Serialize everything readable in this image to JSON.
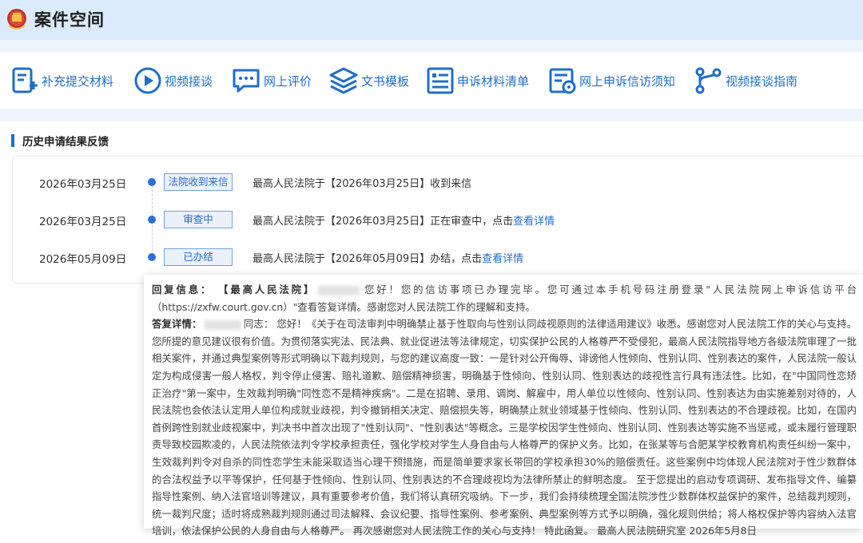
{
  "app": {
    "title": "案件空间"
  },
  "toolbar": {
    "items": [
      {
        "label": "补充提交材料",
        "icon": "document-add-icon"
      },
      {
        "label": "视频接谈",
        "icon": "play-circle-icon"
      },
      {
        "label": "网上评价",
        "icon": "chat-bubble-icon"
      },
      {
        "label": "文书模板",
        "icon": "layers-icon"
      },
      {
        "label": "申诉材料清单",
        "icon": "list-icon"
      },
      {
        "label": "网上申诉信访须知",
        "icon": "notice-icon"
      },
      {
        "label": "视频接谈指南",
        "icon": "flow-icon"
      }
    ]
  },
  "history": {
    "title": "历史申请结果反馈",
    "rows": [
      {
        "date": "2026年03月25日",
        "status": "法院收到来信",
        "text": "最高人民法院于【2026年03月25日】收到来信",
        "link": ""
      },
      {
        "date": "2026年03月25日",
        "status": "审查中",
        "text": "最高人民法院于【2026年03月25日】正在审查中，点击",
        "link": "查看详情"
      },
      {
        "date": "2026年05月09日",
        "status": "已办结",
        "text": "最高人民法院于【2026年05月09日】办结，点击",
        "link": "查看详情"
      }
    ]
  },
  "reply": {
    "info_label": "回复信息：",
    "info_org": "【最高人民法院】",
    "info_text": "您好！您的信访事项已办理完毕。您可通过本手机号码注册登录\"人民法院网上申诉信访平台（https://zxfw.court.gov.cn）\"查看答复详情。感谢您对人民法院工作的理解和支持。",
    "detail_label": "答复详情：",
    "detail_salutation": "同志：",
    "detail_text": "您好！《关于在司法审判中明确禁止基于性取向与性别认同歧视原则的法律适用建议》收悉。感谢您对人民法院工作的关心与支持。 您所提的意见建议很有价值。为贯彻落实宪法、民法典、就业促进法等法律规定，切实保护公民的人格尊严不受侵犯，最高人民法院指导地方各级法院审理了一批相关案件，并通过典型案例等形式明确以下裁判规则，与您的建议高度一致：一是针对公开侮辱、诽谤他人性倾向、性别认同、性别表达的案件，人民法院一般认定为构成侵害一般人格权，判令停止侵害、赔礼道歉、赔偿精神损害，明确基于性倾向、性别认同、性别表达的歧视性言行具有违法性。比如，在\"中国同性恋矫正治疗\"第一案中，生效裁判明确\"同性恋不是精神疾病\"。二是在招聘、录用、调岗、解雇中，用人单位以性倾向、性别认同、性别表达为由实施差别对待的，人民法院也会依法认定用人单位构成就业歧视，判令撤销相关决定、赔偿损失等，明确禁止就业领域基于性倾向、性别认同、性别表达的不合理歧视。比如，在国内首例跨性别就业歧视案中，判决书中首次出现了\"性别认同\"、\"性别表达\"等概念。三是学校因学生性倾向、性别认同、性别表达等实施不当惩戒，或未履行管理职责导致校园欺凌的，人民法院依法判令学校承担责任，强化学校对学生人身自由与人格尊严的保护义务。比如，在张某等与合肥某学校教育机构责任纠纷一案中，生效裁判判令对自杀的同性恋学生未能采取适当心理干预措施，而是简单要求家长带回的学校承担30%的赔偿责任。这些案例中均体现人民法院对于性少数群体的合法权益予以平等保护，任何基于性倾向、性别认同、性别表达的不合理歧视均为法律所禁止的鲜明态度。 至于您提出的启动专项调研、发布指导文件、编纂指导性案例、纳入法官培训等建议，具有重要参考价值，我们将认真研究吸纳。下一步，我们会持续梳理全国法院涉性少数群体权益保护的案件，总结裁判规则，统一裁判尺度；适时将成熟裁判规则通过司法解释、会议纪要、指导性案例、参考案例、典型案例等方式予以明确，强化规则供给；将人格权保护等内容纳入法官培训，依法保护公民的人身自由与人格尊严。 再次感谢您对人民法院工作的关心与支持！ 特此函复。 最高人民法院研究室 2026年5月8日"
  },
  "colors": {
    "accent": "#1f6fc9",
    "header_bg": "#dcebfb",
    "dot": "#2b6fdf"
  }
}
